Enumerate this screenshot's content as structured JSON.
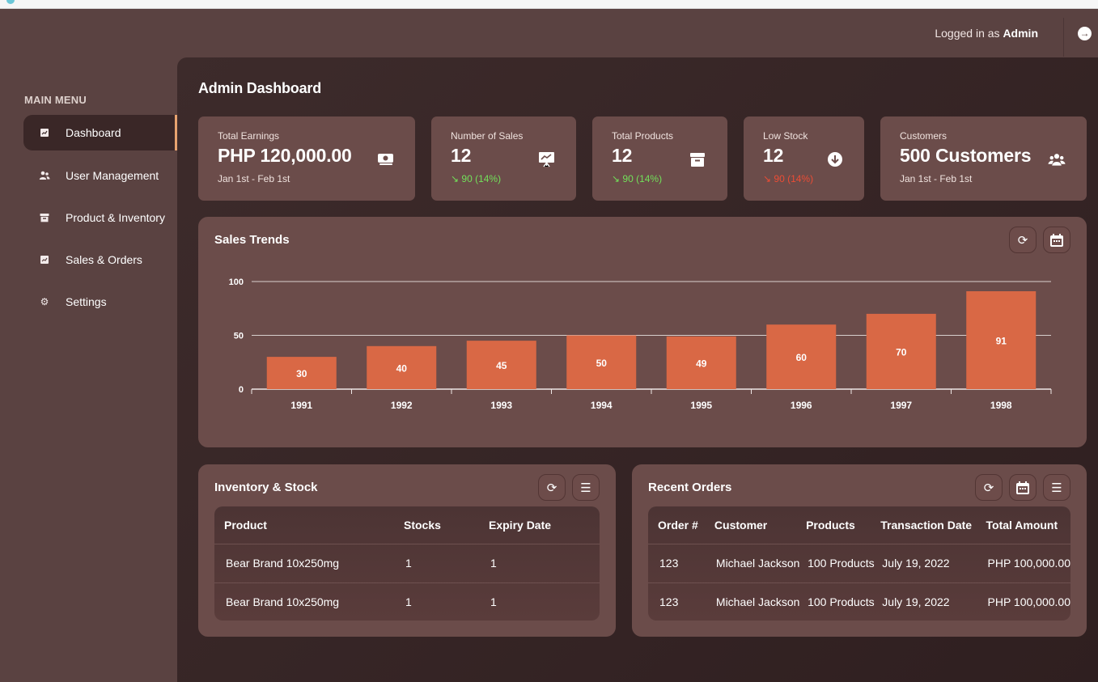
{
  "header": {
    "logged_in_prefix": "Logged in as",
    "logged_in_user": "Admin",
    "logout_icon": "arrow-right-circle-icon"
  },
  "sidebar": {
    "title": "MAIN MENU",
    "items": [
      {
        "label": "Dashboard",
        "icon": "chart-icon",
        "active": true
      },
      {
        "label": "User Management",
        "icon": "users-icon",
        "active": false
      },
      {
        "label": "Product & Inventory",
        "icon": "archive-icon",
        "active": false
      },
      {
        "label": "Sales & Orders",
        "icon": "chart-icon",
        "active": false
      },
      {
        "label": "Settings",
        "icon": "gear-icon",
        "active": false
      }
    ]
  },
  "page": {
    "title": "Admin Dashboard"
  },
  "cards": [
    {
      "title": "Total Earnings",
      "value": "PHP 120,000.00",
      "sub": "Jan 1st - Feb 1st",
      "icon": "money-icon"
    },
    {
      "title": "Number of Sales",
      "value": "12",
      "sub": "↘ 90 (14%)",
      "trend": "positive",
      "icon": "presentation-chart-icon"
    },
    {
      "title": "Total Products",
      "value": "12",
      "sub": "↘ 90 (14%)",
      "trend": "positive",
      "icon": "archive-icon"
    },
    {
      "title": "Low Stock",
      "value": "12",
      "sub": "↘ 90 (14%)",
      "trend": "negative",
      "icon": "arrow-down-circle-icon"
    },
    {
      "title": "Customers",
      "value": "500 Customers",
      "sub": "Jan 1st - Feb 1st",
      "icon": "users-icon"
    }
  ],
  "sales_trends": {
    "title": "Sales Trends",
    "buttons": [
      "refresh-icon",
      "calendar-icon"
    ]
  },
  "chart_data": {
    "type": "bar",
    "categories": [
      "1991",
      "1992",
      "1993",
      "1994",
      "1995",
      "1996",
      "1997",
      "1998"
    ],
    "values": [
      30,
      40,
      45,
      50,
      49,
      60,
      70,
      91
    ],
    "title": "",
    "xlabel": "",
    "ylabel": "",
    "ylim": [
      0,
      100
    ],
    "yticks": [
      0,
      50,
      100
    ],
    "grid": true,
    "bar_color": "#d96845"
  },
  "inventory": {
    "title": "Inventory & Stock",
    "buttons": [
      "refresh-icon",
      "list-icon"
    ],
    "columns": [
      "Product",
      "Stocks",
      "Expiry Date"
    ],
    "rows": [
      [
        "Bear Brand 10x250mg",
        "1",
        "1"
      ],
      [
        "Bear Brand 10x250mg",
        "1",
        "1"
      ]
    ]
  },
  "orders": {
    "title": "Recent Orders",
    "buttons": [
      "refresh-icon",
      "calendar-icon",
      "list-icon"
    ],
    "columns": [
      "Order #",
      "Customer",
      "Products",
      "Transaction Date",
      "Total Amount"
    ],
    "rows": [
      [
        "123",
        "Michael Jackson",
        "100 Products",
        "July 19, 2022",
        "PHP 100,000.00"
      ],
      [
        "123",
        "Michael Jackson",
        "100 Products",
        "July 19, 2022",
        "PHP 100,000.00"
      ]
    ]
  }
}
